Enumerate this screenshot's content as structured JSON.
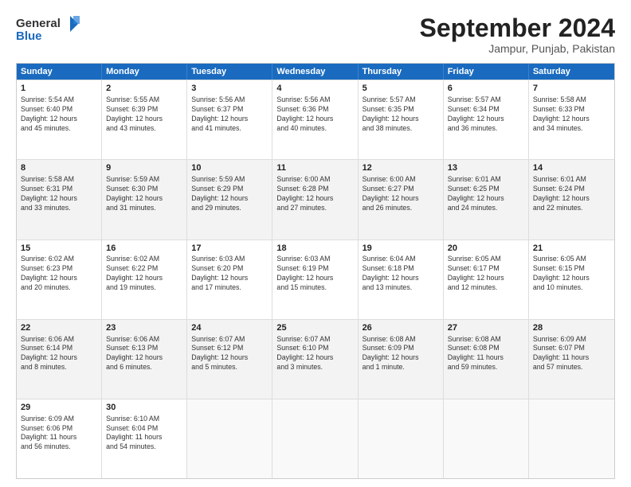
{
  "logo": {
    "line1": "General",
    "line2": "Blue"
  },
  "title": "September 2024",
  "subtitle": "Jampur, Punjab, Pakistan",
  "days": [
    "Sunday",
    "Monday",
    "Tuesday",
    "Wednesday",
    "Thursday",
    "Friday",
    "Saturday"
  ],
  "weeks": [
    [
      {
        "day": 1,
        "info": "Sunrise: 5:54 AM\nSunset: 6:40 PM\nDaylight: 12 hours\nand 45 minutes."
      },
      {
        "day": 2,
        "info": "Sunrise: 5:55 AM\nSunset: 6:39 PM\nDaylight: 12 hours\nand 43 minutes."
      },
      {
        "day": 3,
        "info": "Sunrise: 5:56 AM\nSunset: 6:37 PM\nDaylight: 12 hours\nand 41 minutes."
      },
      {
        "day": 4,
        "info": "Sunrise: 5:56 AM\nSunset: 6:36 PM\nDaylight: 12 hours\nand 40 minutes."
      },
      {
        "day": 5,
        "info": "Sunrise: 5:57 AM\nSunset: 6:35 PM\nDaylight: 12 hours\nand 38 minutes."
      },
      {
        "day": 6,
        "info": "Sunrise: 5:57 AM\nSunset: 6:34 PM\nDaylight: 12 hours\nand 36 minutes."
      },
      {
        "day": 7,
        "info": "Sunrise: 5:58 AM\nSunset: 6:33 PM\nDaylight: 12 hours\nand 34 minutes."
      }
    ],
    [
      {
        "day": 8,
        "info": "Sunrise: 5:58 AM\nSunset: 6:31 PM\nDaylight: 12 hours\nand 33 minutes."
      },
      {
        "day": 9,
        "info": "Sunrise: 5:59 AM\nSunset: 6:30 PM\nDaylight: 12 hours\nand 31 minutes."
      },
      {
        "day": 10,
        "info": "Sunrise: 5:59 AM\nSunset: 6:29 PM\nDaylight: 12 hours\nand 29 minutes."
      },
      {
        "day": 11,
        "info": "Sunrise: 6:00 AM\nSunset: 6:28 PM\nDaylight: 12 hours\nand 27 minutes."
      },
      {
        "day": 12,
        "info": "Sunrise: 6:00 AM\nSunset: 6:27 PM\nDaylight: 12 hours\nand 26 minutes."
      },
      {
        "day": 13,
        "info": "Sunrise: 6:01 AM\nSunset: 6:25 PM\nDaylight: 12 hours\nand 24 minutes."
      },
      {
        "day": 14,
        "info": "Sunrise: 6:01 AM\nSunset: 6:24 PM\nDaylight: 12 hours\nand 22 minutes."
      }
    ],
    [
      {
        "day": 15,
        "info": "Sunrise: 6:02 AM\nSunset: 6:23 PM\nDaylight: 12 hours\nand 20 minutes."
      },
      {
        "day": 16,
        "info": "Sunrise: 6:02 AM\nSunset: 6:22 PM\nDaylight: 12 hours\nand 19 minutes."
      },
      {
        "day": 17,
        "info": "Sunrise: 6:03 AM\nSunset: 6:20 PM\nDaylight: 12 hours\nand 17 minutes."
      },
      {
        "day": 18,
        "info": "Sunrise: 6:03 AM\nSunset: 6:19 PM\nDaylight: 12 hours\nand 15 minutes."
      },
      {
        "day": 19,
        "info": "Sunrise: 6:04 AM\nSunset: 6:18 PM\nDaylight: 12 hours\nand 13 minutes."
      },
      {
        "day": 20,
        "info": "Sunrise: 6:05 AM\nSunset: 6:17 PM\nDaylight: 12 hours\nand 12 minutes."
      },
      {
        "day": 21,
        "info": "Sunrise: 6:05 AM\nSunset: 6:15 PM\nDaylight: 12 hours\nand 10 minutes."
      }
    ],
    [
      {
        "day": 22,
        "info": "Sunrise: 6:06 AM\nSunset: 6:14 PM\nDaylight: 12 hours\nand 8 minutes."
      },
      {
        "day": 23,
        "info": "Sunrise: 6:06 AM\nSunset: 6:13 PM\nDaylight: 12 hours\nand 6 minutes."
      },
      {
        "day": 24,
        "info": "Sunrise: 6:07 AM\nSunset: 6:12 PM\nDaylight: 12 hours\nand 5 minutes."
      },
      {
        "day": 25,
        "info": "Sunrise: 6:07 AM\nSunset: 6:10 PM\nDaylight: 12 hours\nand 3 minutes."
      },
      {
        "day": 26,
        "info": "Sunrise: 6:08 AM\nSunset: 6:09 PM\nDaylight: 12 hours\nand 1 minute."
      },
      {
        "day": 27,
        "info": "Sunrise: 6:08 AM\nSunset: 6:08 PM\nDaylight: 11 hours\nand 59 minutes."
      },
      {
        "day": 28,
        "info": "Sunrise: 6:09 AM\nSunset: 6:07 PM\nDaylight: 11 hours\nand 57 minutes."
      }
    ],
    [
      {
        "day": 29,
        "info": "Sunrise: 6:09 AM\nSunset: 6:06 PM\nDaylight: 11 hours\nand 56 minutes."
      },
      {
        "day": 30,
        "info": "Sunrise: 6:10 AM\nSunset: 6:04 PM\nDaylight: 11 hours\nand 54 minutes."
      },
      null,
      null,
      null,
      null,
      null
    ]
  ]
}
